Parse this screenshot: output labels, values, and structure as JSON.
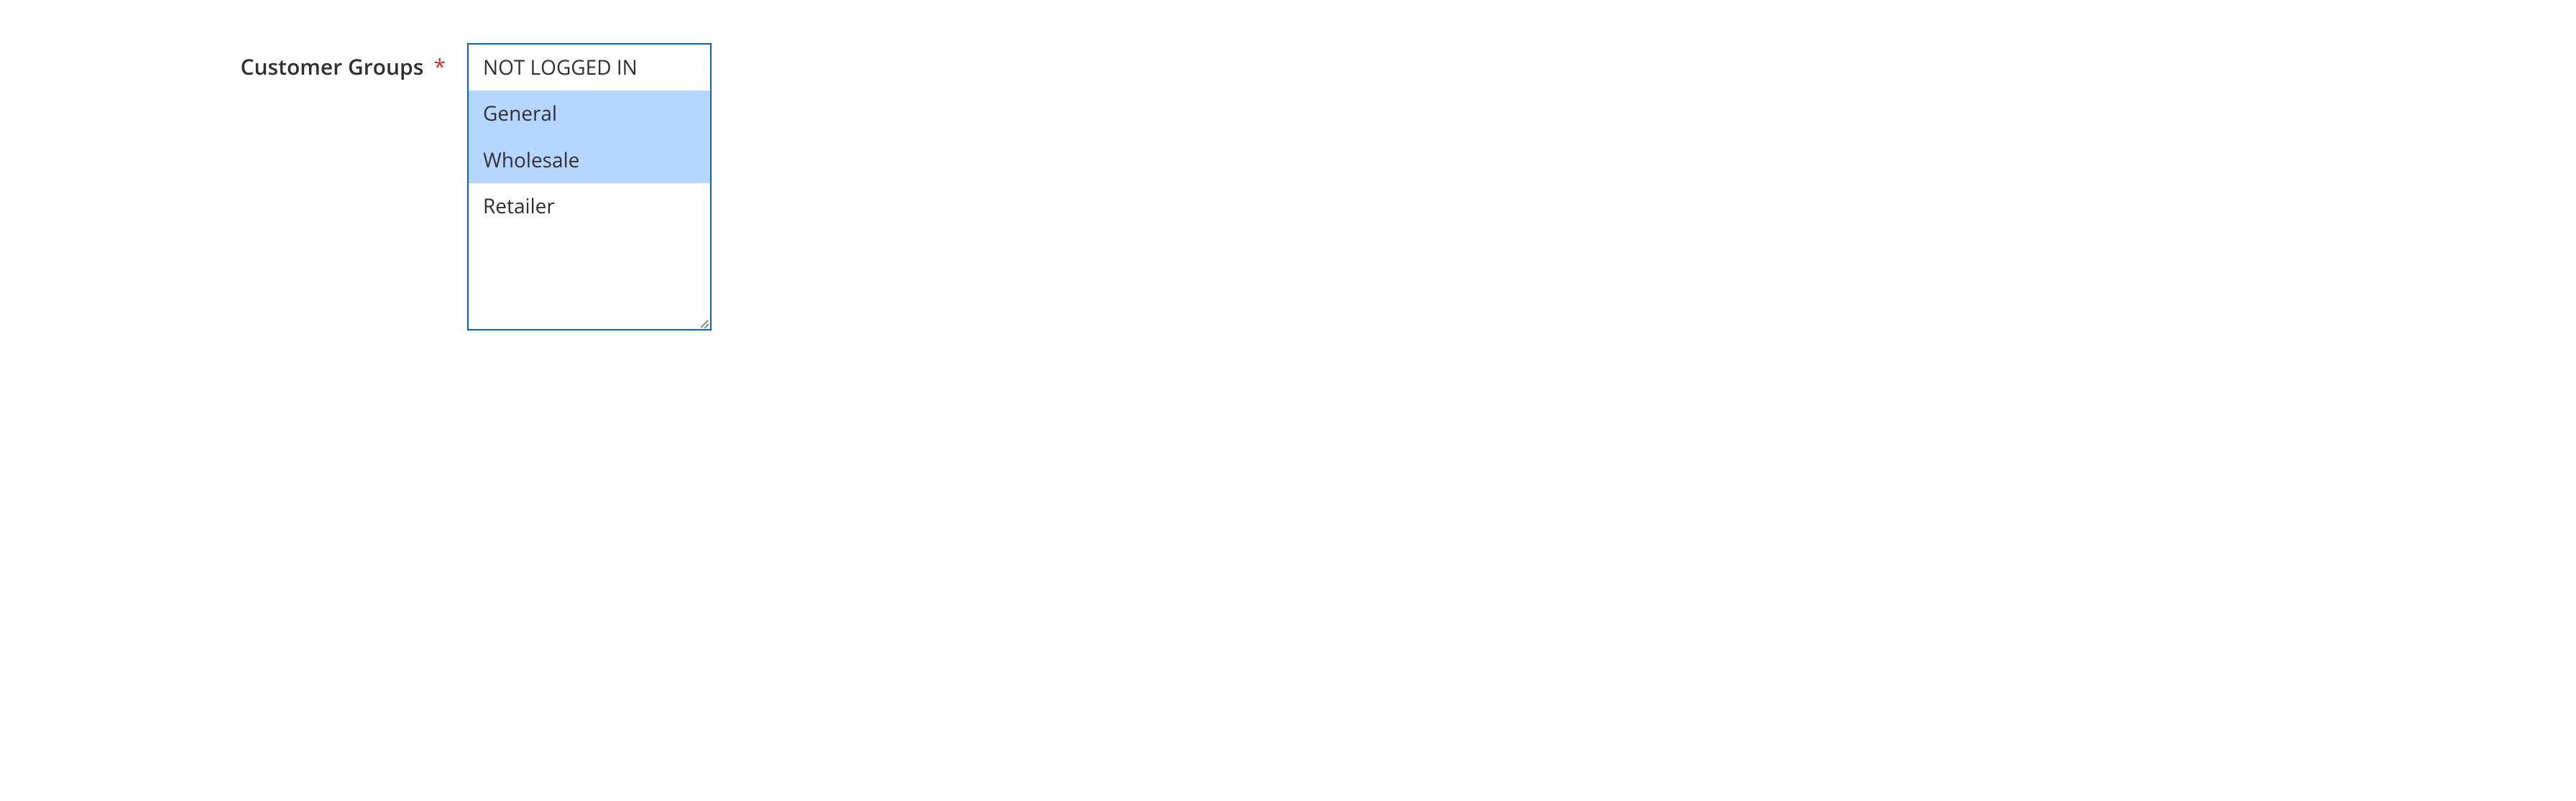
{
  "field": {
    "label": "Customer Groups",
    "required_mark": "*",
    "options": [
      {
        "label": "NOT LOGGED IN",
        "selected": false
      },
      {
        "label": "General",
        "selected": true
      },
      {
        "label": "Wholesale",
        "selected": true
      },
      {
        "label": "Retailer",
        "selected": false
      }
    ]
  }
}
